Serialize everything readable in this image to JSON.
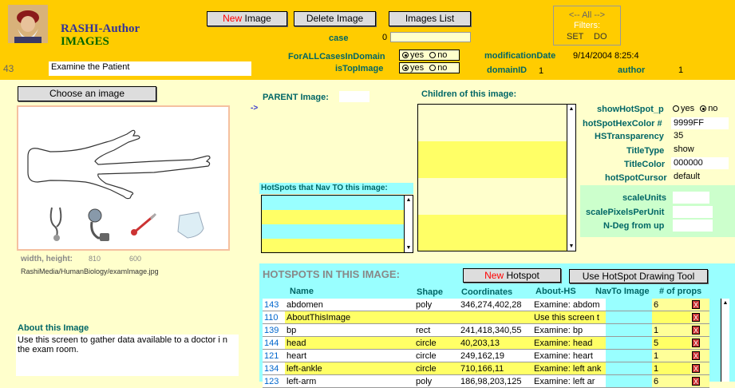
{
  "app": {
    "title": "RASHI-Author",
    "section": "IMAGES"
  },
  "header": {
    "record_number": "43",
    "image_title": "Examine the Patient",
    "buttons": {
      "new_word": "New",
      "new_rest": " Image",
      "delete": "Delete Image",
      "list": "Images List"
    },
    "filter": {
      "all": "<-- All -->",
      "filters": "Filters:",
      "set": "SET",
      "do": "DO"
    },
    "case": {
      "label": "case",
      "value": "0"
    },
    "for_all_cases": {
      "label": "ForALLCasesInDomain",
      "yes": "yes",
      "no": "no",
      "selected": "yes"
    },
    "is_top_image": {
      "label": "isTopImage",
      "yes": "yes",
      "no": "no",
      "selected": "yes"
    },
    "modification_date": {
      "label": "modificationDate",
      "value": "9/14/2004 8:25:4"
    },
    "domain_id": {
      "label": "domainID",
      "value": "1"
    },
    "author": {
      "label": "author",
      "value": "1"
    }
  },
  "left": {
    "choose_button": "Choose an image",
    "width_height": {
      "label": "width, height:",
      "width": "810",
      "height": "600"
    },
    "path": "RashiMedia/HumanBiology/examImage.jpg",
    "about_label": "About this Image",
    "about_text": "Use this screen to gather data available to a doctor i n the exam room."
  },
  "middle": {
    "parent_label": "PARENT Image:",
    "parent_arrow": "->",
    "children_label": "Children of this image:",
    "hotspots_nav_label": "HotSpots that Nav TO this image:"
  },
  "props": {
    "show_hotspot": {
      "label": "showHotSpot_p",
      "yes": "yes",
      "no": "no",
      "selected": "no"
    },
    "hotspot_hex_color": {
      "label": "hotSpotHexColor #",
      "value": "9999FF"
    },
    "hs_transparency": {
      "label": "HSTransparency",
      "value": "35"
    },
    "title_type": {
      "label": "TitleType",
      "value": "show"
    },
    "title_color": {
      "label": "TitleColor",
      "value": "000000"
    },
    "hotspot_cursor": {
      "label": "hotSpotCursor",
      "value": "default"
    },
    "scale_units": {
      "label": "scaleUnits",
      "value": ""
    },
    "scale_pixels": {
      "label": "scalePixelsPerUnit",
      "value": ""
    },
    "n_deg": {
      "label": "N-Deg from up",
      "value": ""
    }
  },
  "hotspots": {
    "title": "HOTSPOTS IN THIS IMAGE:",
    "new_word": "New",
    "new_rest": " Hotspot",
    "drawing_tool": "Use HotSpot Drawing Tool",
    "columns": [
      "Name",
      "Shape",
      "Coordinates",
      "About-HS",
      "NavTo Image",
      "# of props"
    ],
    "delete_glyph": "X",
    "rows": [
      {
        "id": "143",
        "name": "abdomen",
        "shape": "poly",
        "coords": "346,274,402,28",
        "about": "Examine: abdom",
        "nav": "",
        "props": "6"
      },
      {
        "id": "110",
        "name": "AboutThisImage",
        "shape": "",
        "coords": "",
        "about": "Use this screen t",
        "nav": "",
        "props": ""
      },
      {
        "id": "139",
        "name": "bp",
        "shape": "rect",
        "coords": "241,418,340,55",
        "about": "Examine: bp",
        "nav": "",
        "props": "1"
      },
      {
        "id": "144",
        "name": "head",
        "shape": "circle",
        "coords": "40,203,13",
        "about": "Examine: head",
        "nav": "",
        "props": "5"
      },
      {
        "id": "121",
        "name": "heart",
        "shape": "circle",
        "coords": "249,162,19",
        "about": "Examine: heart",
        "nav": "",
        "props": "1"
      },
      {
        "id": "134",
        "name": "left-ankle",
        "shape": "circle",
        "coords": "710,166,11",
        "about": "Examine: left ank",
        "nav": "",
        "props": "1"
      },
      {
        "id": "123",
        "name": "left-arm",
        "shape": "poly",
        "coords": "186,98,203,125",
        "about": "Examine: left ar",
        "nav": "",
        "props": "6"
      }
    ]
  },
  "colors": {
    "header_bg": "#FFCC00",
    "panel_bg": "#FFFFCC",
    "cyan": "#99FFFF",
    "yellow_cell": "#FFFF66",
    "green": "#CCFFCC",
    "teal_label": "#006666"
  }
}
